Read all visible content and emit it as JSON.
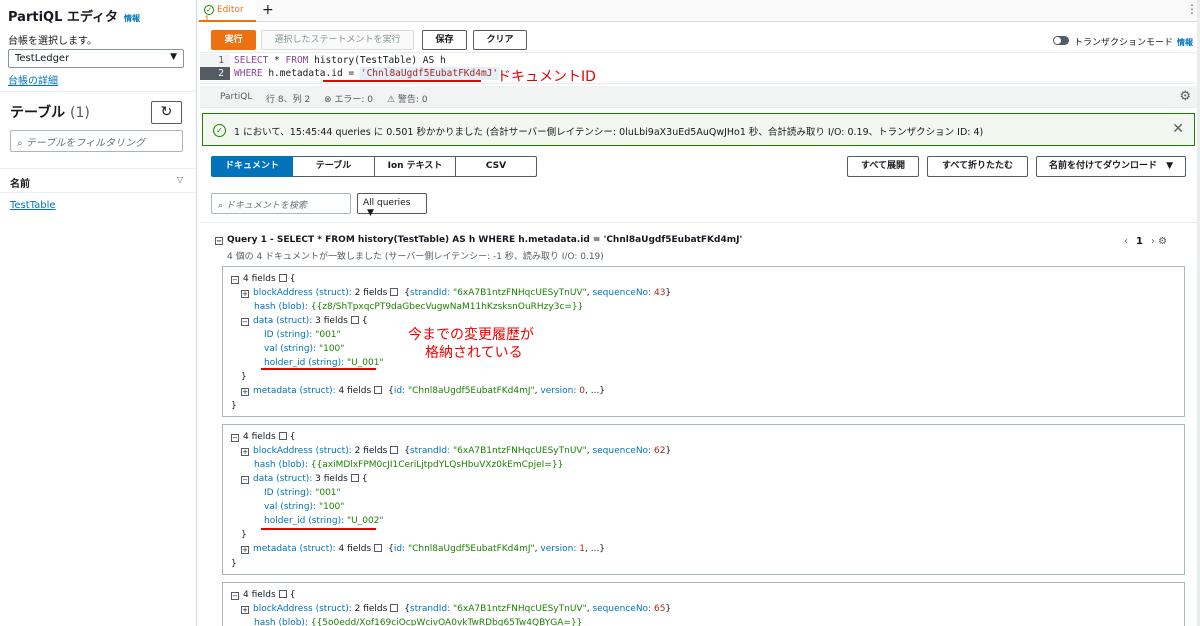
{
  "sidebar": {
    "title": "PartiQL エディタ",
    "info": "情報",
    "ledger_label": "台帳を選択します。",
    "ledger_value": "TestLedger",
    "ledger_link": "台帳の詳細",
    "tables_heading": "テーブル",
    "tables_count": "(1)",
    "filter_placeholder": "テーブルをフィルタリング",
    "name_header": "名前",
    "table_item": "TestTable"
  },
  "tabs": {
    "active": "Editor 1"
  },
  "toolbar": {
    "run": "実行",
    "run_selected": "選択したステートメントを実行",
    "save": "保存",
    "clear": "クリア",
    "txn_mode": "トランザクションモード",
    "info": "情報"
  },
  "editor": {
    "line1_no": "1",
    "line2_no": "2",
    "line1_kw1": "SELECT",
    "line1_mid": " * ",
    "line1_kw2": "FROM",
    "line1_rest": " history(TestTable) AS h",
    "line2_kw": "WHERE",
    "line2_rest": " h.metadata.id = ",
    "line2_str": "'Chnl8aUgdf5EubatFKd4mJ'"
  },
  "annotations": {
    "doc_id": "ドキュメントID",
    "history_line1": "今までの変更履歴が",
    "history_line2": "格納されている"
  },
  "status": {
    "lang": "PartiQL",
    "pos": "行 8、列 2",
    "errors": "⊗ エラー: 0",
    "warnings": "⚠ 警告: 0"
  },
  "success": {
    "message": "1 において、15:45:44 queries に 0.501 秒かかりました (合計サーバー側レイテンシー: 0luLbi9aX3uEd5AuQwJHo1 秒、合計読み取り I/O: 0.19、トランザクション ID: 4)"
  },
  "views": {
    "tabs": [
      "ドキュメント",
      "テーブル",
      "Ion テキスト",
      "CSV"
    ],
    "expand_all": "すべて展開",
    "collapse_all": "すべて折りたたむ",
    "download": "名前を付けてダウンロード",
    "search_placeholder": "ドキュメントを検索",
    "query_filter": "All queries"
  },
  "query": {
    "header": "Query 1 - SELECT * FROM history(TestTable) AS h WHERE h.metadata.id = 'Chnl8aUgdf5EubatFKd4mJ'",
    "summary": "4 個の 4 ドキュメントが一致しました (サーバー側レイテンシー: -1 秒、読み取り I/O: 0.19)",
    "page": "1"
  },
  "documents": [
    {
      "fields": "4 fields",
      "block_key": "blockAddress (struct):",
      "block_count": "2 fields",
      "strand_key": "strandId:",
      "strand_val": "\"6xA7B1ntzFNHqcUESyTnUV\"",
      "seq_key": "sequenceNo:",
      "seq_val": "43",
      "hash_key": "hash (blob):",
      "hash_val": "{{z8/ShTpxqcPT9daGbecVugwNaM11hKzsksnOuRHzy3c=}}",
      "data_key": "data (struct):",
      "data_count": "3 fields",
      "id_key": "ID (string):",
      "id_val": "\"001\"",
      "val_key": "val (string):",
      "val_val": "\"100\"",
      "holder_key": "holder_id (string):",
      "holder_val": "\"U_001\"",
      "meta_key": "metadata (struct):",
      "meta_count": "4 fields",
      "meta_id_key": "id:",
      "meta_id_val": "\"Chnl8aUgdf5EubatFKd4mJ\"",
      "version_key": "version:",
      "version_val": "0"
    },
    {
      "fields": "4 fields",
      "block_key": "blockAddress (struct):",
      "block_count": "2 fields",
      "strand_key": "strandId:",
      "strand_val": "\"6xA7B1ntzFNHqcUESyTnUV\"",
      "seq_key": "sequenceNo:",
      "seq_val": "62",
      "hash_key": "hash (blob):",
      "hash_val": "{{axiMDlxFPM0cJI1CeriLjtpdYLQsHbuVXz0kEmCpjeI=}}",
      "data_key": "data (struct):",
      "data_count": "3 fields",
      "id_key": "ID (string):",
      "id_val": "\"001\"",
      "val_key": "val (string):",
      "val_val": "\"100\"",
      "holder_key": "holder_id (string):",
      "holder_val": "\"U_002\"",
      "meta_key": "metadata (struct):",
      "meta_count": "4 fields",
      "meta_id_key": "id:",
      "meta_id_val": "\"Chnl8aUgdf5EubatFKd4mJ\"",
      "version_key": "version:",
      "version_val": "1"
    },
    {
      "fields": "4 fields",
      "block_key": "blockAddress (struct):",
      "block_count": "2 fields",
      "strand_key": "strandId:",
      "strand_val": "\"6xA7B1ntzFNHqcUESyTnUV\"",
      "seq_key": "sequenceNo:",
      "seq_val": "65",
      "hash_key": "hash (blob):",
      "hash_val": "{{5o0edd/Xof169ciOcpWcivOA0vkTwRDbg65Tw4QBYGA=}}"
    }
  ],
  "colors": {
    "accent": "#ec7211",
    "link": "#0073bb",
    "success": "#1d8102",
    "annotation": "#ee0000"
  }
}
